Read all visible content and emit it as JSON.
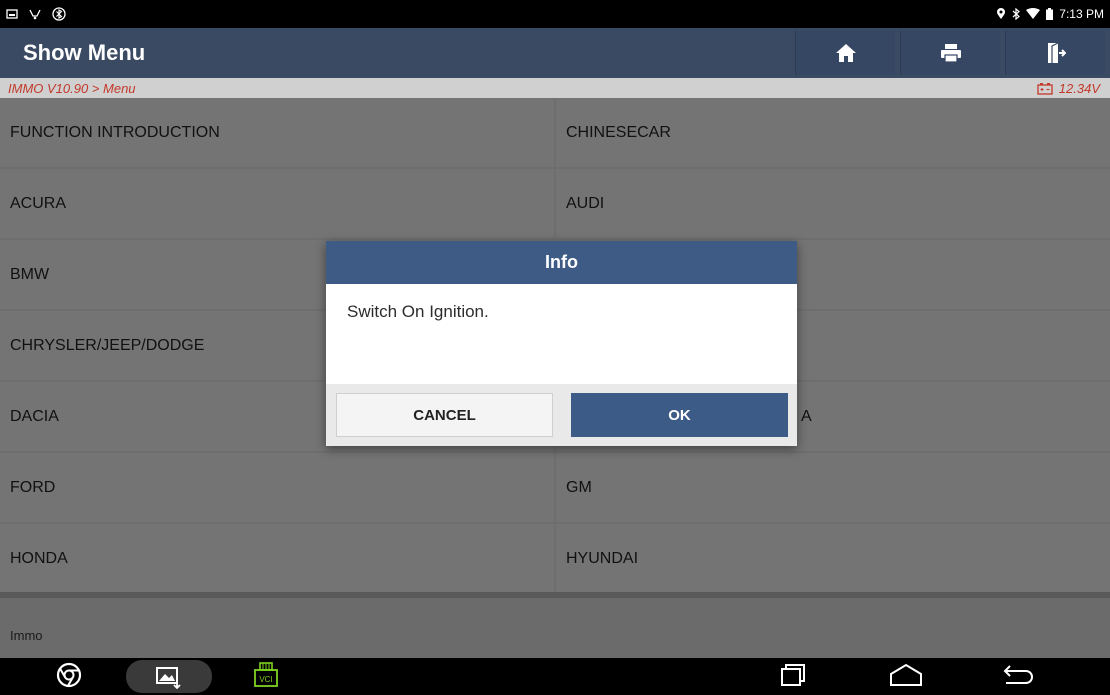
{
  "status_bar": {
    "left_icons": [
      "notification-icon",
      "usb-icon",
      "bluetooth-circle-icon"
    ],
    "right_icons": [
      "location-icon",
      "bluetooth-icon",
      "wifi-icon",
      "battery-icon"
    ],
    "time": "7:13 PM"
  },
  "header": {
    "title": "Show Menu",
    "buttons": [
      "home-icon",
      "printer-icon",
      "exit-icon"
    ]
  },
  "breadcrumb": {
    "path": "IMMO V10.90 > Menu",
    "voltage": "12.34V"
  },
  "menu": {
    "left": [
      "FUNCTION INTRODUCTION",
      "ACURA",
      "BMW",
      "CHRYSLER/JEEP/DODGE",
      "DACIA",
      "FORD",
      "HONDA"
    ],
    "right": [
      "CHINESECAR",
      "AUDI",
      "",
      "",
      "A",
      "GM",
      "HYUNDAI"
    ]
  },
  "footer": {
    "label": "Immo"
  },
  "dialog": {
    "title": "Info",
    "message": "Switch On Ignition.",
    "cancel_label": "CANCEL",
    "ok_label": "OK"
  },
  "nav": {
    "vci_label": "VCI"
  },
  "colors": {
    "header": "#3a4a63",
    "dialog_header": "#3e5b85",
    "ok_button": "#3d5b87",
    "breadcrumb_text": "#c2382a"
  }
}
